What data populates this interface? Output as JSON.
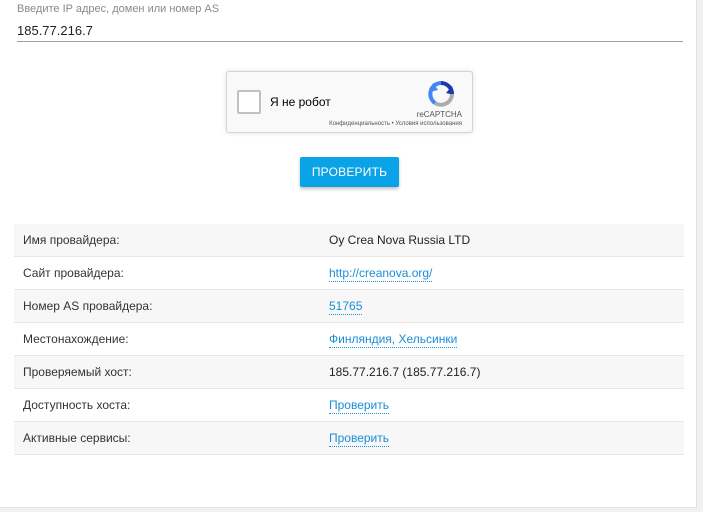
{
  "form": {
    "ip_label": "Введите IP адрес, домен или номер AS",
    "ip_value": "185.77.216.7",
    "submit_label": "ПРОВЕРИТЬ"
  },
  "captcha": {
    "label": "Я не робот",
    "brand": "reCAPTCHA",
    "privacy": "Конфиденциальность",
    "separator": " • ",
    "terms": "Условия использования"
  },
  "results": {
    "rows": [
      {
        "key": "Имя провайдера:",
        "value": "Oy Crea Nova Russia LTD"
      },
      {
        "key": "Сайт провайдера:",
        "value": "http://creanova.org/"
      },
      {
        "key": "Номер AS провайдера:",
        "value": "51765"
      },
      {
        "key": "Местонахождение:",
        "value": "Финляндия, Хельсинки"
      },
      {
        "key": "Проверяемый хост:",
        "value": "185.77.216.7 (185.77.216.7)"
      },
      {
        "key": "Доступность хоста:",
        "value": "Проверить"
      },
      {
        "key": "Активные сервисы:",
        "value": "Проверить"
      }
    ]
  },
  "colors": {
    "accent": "#0aa3e8",
    "link": "#1a8ed8",
    "recaptcha_blue": "#1c3aa9",
    "recaptcha_light_blue": "#4285f4",
    "recaptcha_grey": "#ababab"
  },
  "icons": {
    "captcha_logo": "recaptcha-logo-icon"
  }
}
